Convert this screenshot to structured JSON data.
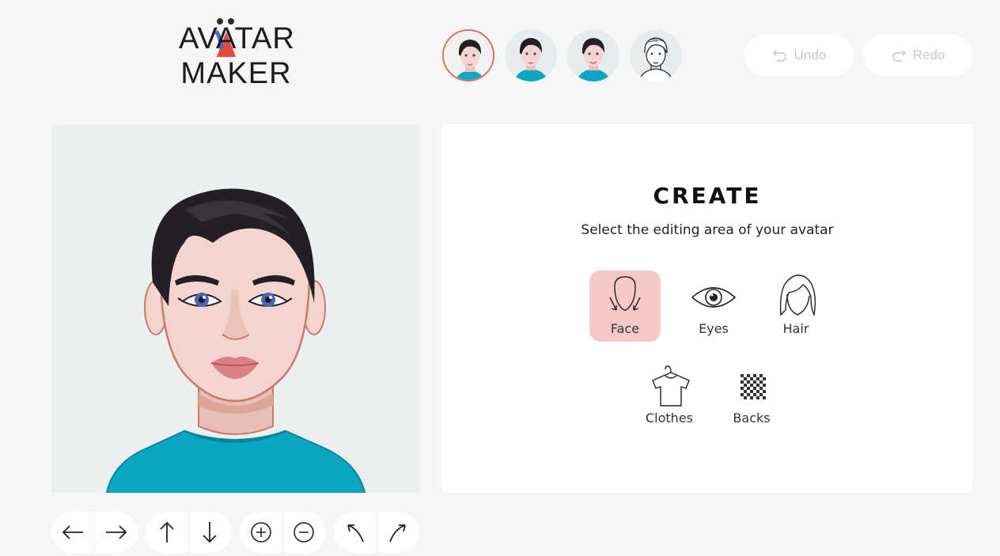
{
  "logo": {
    "line1": "AVATAR",
    "line2": "MAKER"
  },
  "presets": [
    {
      "name": "preset-avatar-1",
      "active": true
    },
    {
      "name": "preset-avatar-2",
      "active": false
    },
    {
      "name": "preset-avatar-3",
      "active": false
    },
    {
      "name": "preset-avatar-4",
      "active": false
    }
  ],
  "toolbar": {
    "undo_label": "Undo",
    "redo_label": "Redo"
  },
  "panel": {
    "title": "CREATE",
    "subtitle": "Select the editing area of your avatar",
    "options": [
      {
        "label": "Face",
        "icon": "face-outline-icon",
        "active": true
      },
      {
        "label": "Eyes",
        "icon": "eye-icon",
        "active": false
      },
      {
        "label": "Hair",
        "icon": "hair-icon",
        "active": false
      },
      {
        "label": "Clothes",
        "icon": "shirt-hanger-icon",
        "active": false
      },
      {
        "label": "Backs",
        "icon": "checker-pattern-icon",
        "active": false
      }
    ]
  },
  "controls": [
    {
      "icon": "arrow-left-icon"
    },
    {
      "icon": "arrow-right-icon"
    },
    {
      "icon": "arrow-up-icon"
    },
    {
      "icon": "arrow-down-icon"
    },
    {
      "icon": "zoom-in-icon"
    },
    {
      "icon": "zoom-out-icon"
    },
    {
      "icon": "rotate-left-icon"
    },
    {
      "icon": "rotate-right-icon"
    }
  ],
  "colors": {
    "accent": "#e07060",
    "active_option_bg": "#f6c8c8",
    "shirt": "#0aa7c4",
    "hair": "#231f24",
    "skin": "#f3d4cf"
  }
}
